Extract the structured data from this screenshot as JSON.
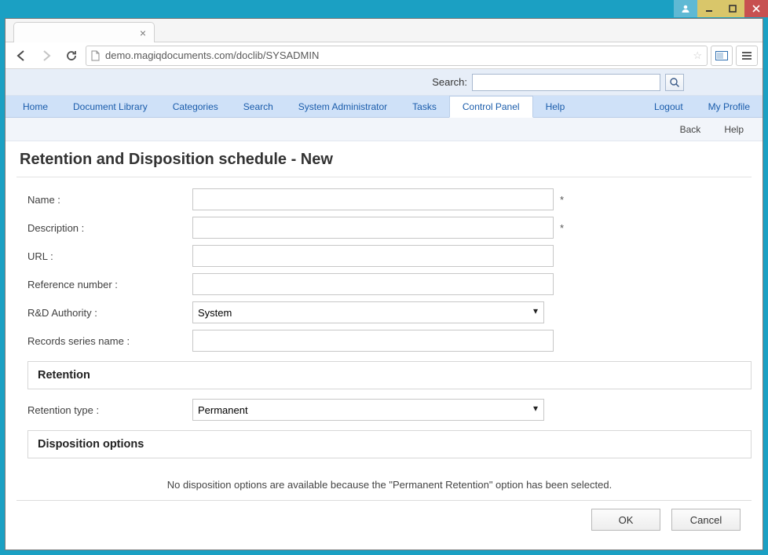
{
  "browser": {
    "url": "demo.magiqdocuments.com/doclib/SYSADMIN"
  },
  "searchbar": {
    "label": "Search:"
  },
  "nav": {
    "items": [
      {
        "label": "Home"
      },
      {
        "label": "Document Library"
      },
      {
        "label": "Categories"
      },
      {
        "label": "Search"
      },
      {
        "label": "System Administrator"
      },
      {
        "label": "Tasks"
      },
      {
        "label": "Control Panel"
      },
      {
        "label": "Help"
      }
    ],
    "right": [
      {
        "label": "Logout"
      },
      {
        "label": "My Profile"
      }
    ]
  },
  "sublinks": {
    "back": "Back",
    "help": "Help"
  },
  "page": {
    "title": "Retention and Disposition schedule - New"
  },
  "form": {
    "name_label": "Name :",
    "name_value": "",
    "desc_label": "Description :",
    "desc_value": "",
    "url_label": "URL :",
    "url_value": "",
    "ref_label": "Reference number :",
    "ref_value": "",
    "auth_label": "R&D Authority :",
    "auth_value": "System",
    "series_label": "Records series name :",
    "series_value": "",
    "required_marker": "*",
    "retention_heading": "Retention",
    "rettype_label": "Retention type :",
    "rettype_value": "Permanent",
    "dispo_heading": "Disposition options",
    "dispo_note": "No disposition options are available because the \"Permanent Retention\" option has been selected."
  },
  "buttons": {
    "ok": "OK",
    "cancel": "Cancel"
  }
}
